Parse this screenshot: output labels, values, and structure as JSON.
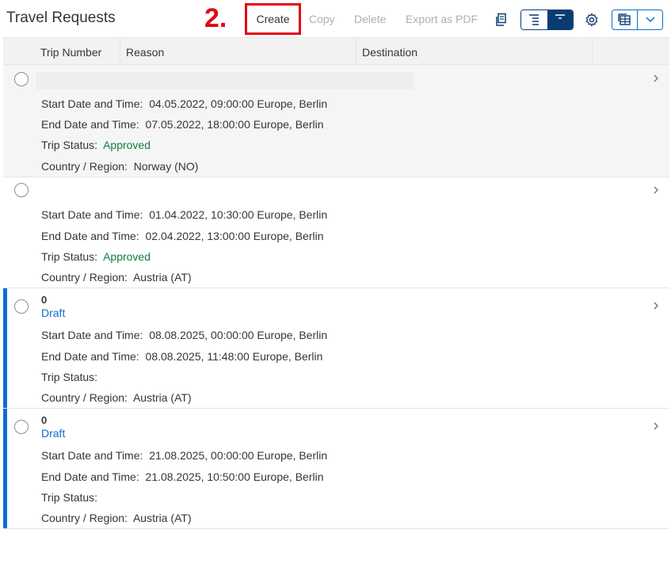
{
  "toolbar": {
    "title": "Travel Requests",
    "step_marker": "2.",
    "create_label": "Create",
    "copy_label": "Copy",
    "delete_label": "Delete",
    "export_label": "Export as PDF"
  },
  "columns": [
    "Trip Number",
    "Reason",
    "Destination"
  ],
  "labels": {
    "start": "Start Date and Time:",
    "end": "End Date and Time:",
    "status": "Trip Status:",
    "country": "Country / Region:"
  },
  "rows": [
    {
      "trip_number": "",
      "tag": "",
      "start": "04.05.2022, 09:00:00 Europe, Berlin",
      "end": "07.05.2022, 18:00:00 Europe, Berlin",
      "status": "Approved",
      "country": "Norway (NO)"
    },
    {
      "trip_number": "",
      "tag": "",
      "start": "01.04.2022, 10:30:00 Europe, Berlin",
      "end": "02.04.2022, 13:00:00 Europe, Berlin",
      "status": "Approved",
      "country": "Austria (AT)"
    },
    {
      "trip_number": "0",
      "tag": "Draft",
      "start": "08.08.2025, 00:00:00 Europe, Berlin",
      "end": "08.08.2025, 11:48:00 Europe, Berlin",
      "status": "",
      "country": "Austria (AT)"
    },
    {
      "trip_number": "0",
      "tag": "Draft",
      "start": "21.08.2025, 00:00:00 Europe, Berlin",
      "end": "21.08.2025, 10:50:00 Europe, Berlin",
      "status": "",
      "country": "Austria (AT)"
    }
  ],
  "colors": {
    "accent": "#0a6ed1",
    "approved": "#107e3e",
    "highlight": "#e30613",
    "segment_active": "#0a3c73"
  }
}
